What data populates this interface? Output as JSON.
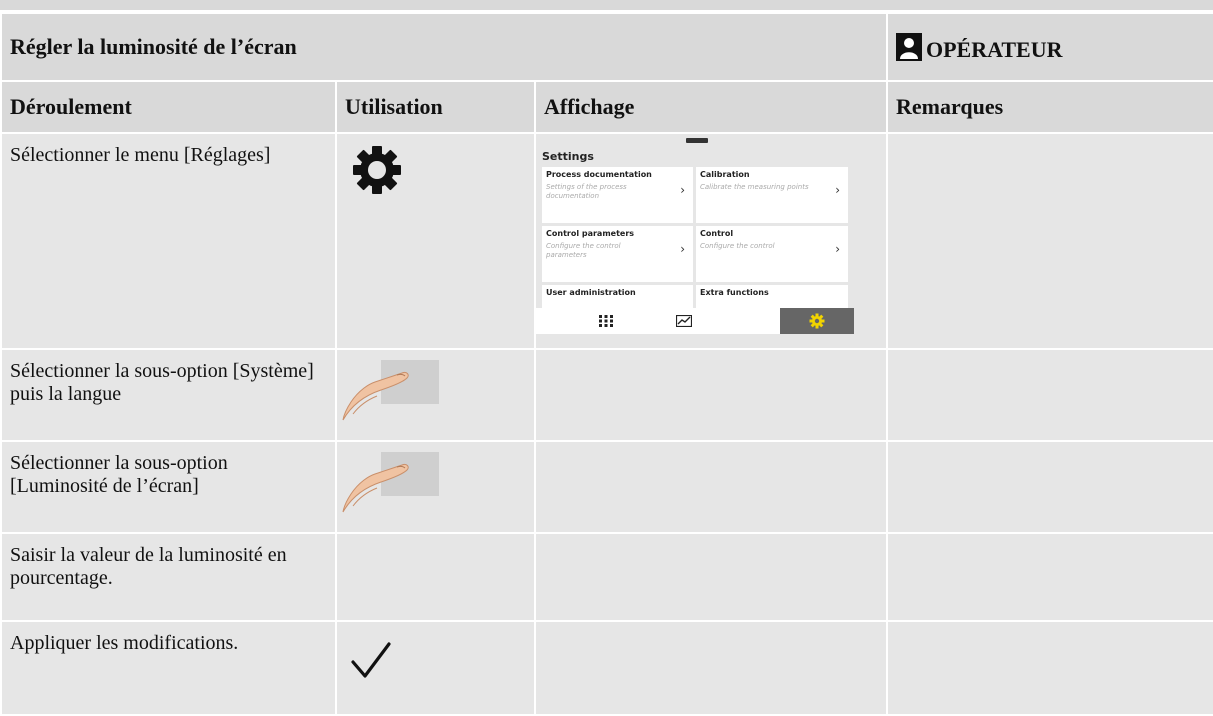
{
  "header": {
    "title": "Régler la luminosité de l’écran",
    "role": "OPÉRATEUR",
    "role_icon": "operator-user-icon"
  },
  "columns": {
    "step": "Déroulement",
    "use": "Utilisation",
    "display": "Affichage",
    "remarks": "Remarques"
  },
  "rows": [
    {
      "text": "Sélectionner le menu [Réglages]",
      "use_icon": "gear-icon"
    },
    {
      "text": "Sélectionner la sous-option [Système] puis la langue",
      "use_icon": "finger-tap-icon"
    },
    {
      "text": "Sélectionner la sous-option [Luminosité de l’écran]",
      "use_icon": "finger-tap-icon"
    },
    {
      "text": "Saisir la valeur de la luminosité en pourcentage.",
      "use_icon": ""
    },
    {
      "text": "Appliquer les modifications.",
      "use_icon": "checkmark-icon"
    }
  ],
  "screen": {
    "title": "Settings",
    "tiles": [
      {
        "title": "Process documentation",
        "subtitle": "Settings of the process documentation"
      },
      {
        "title": "Calibration",
        "subtitle": "Calibrate the measuring points"
      },
      {
        "title": "Control parameters",
        "subtitle": "Configure the control parameters"
      },
      {
        "title": "Control",
        "subtitle": "Configure the control"
      },
      {
        "title": "User administration",
        "subtitle": ""
      },
      {
        "title": "Extra functions",
        "subtitle": ""
      }
    ],
    "nav": [
      "grid-menu-icon",
      "chart-icon",
      "settings-gear-icon"
    ],
    "active_color": "#f2d400"
  }
}
